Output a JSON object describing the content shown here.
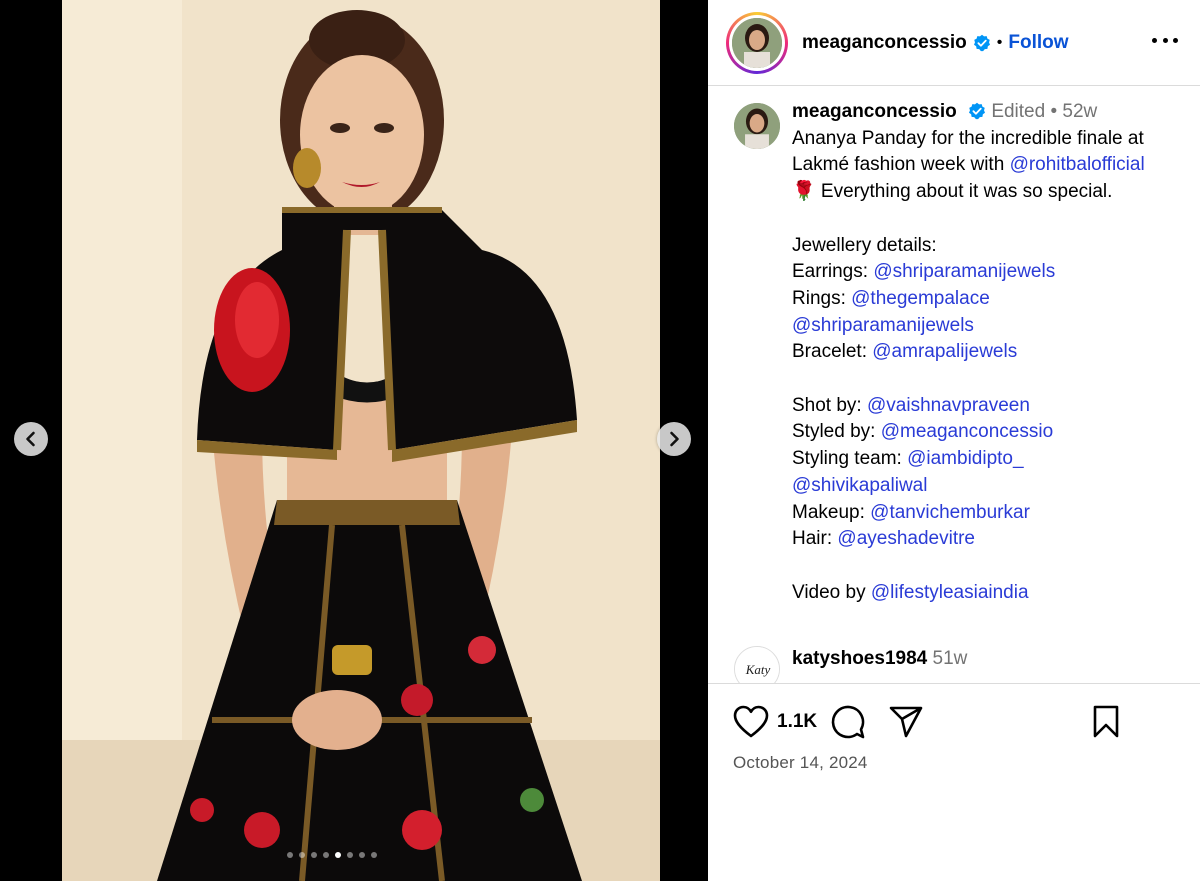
{
  "post": {
    "username": "meaganconcessio",
    "follow_label": "Follow",
    "separator": "•",
    "slides_total": 8,
    "slide_active": 5
  },
  "caption": {
    "username": "meaganconcessio",
    "edited": "Edited",
    "dot": "•",
    "age": "52w",
    "l1": "Ananya Panday for the incredible finale at",
    "l2a": "Lakmé fashion week with ",
    "l2link": "@rohitbalofficial",
    "l3": "🌹 Everything about it was so special.",
    "l4": "Jewellery details:",
    "l5a": "Earrings: ",
    "l5link": "@shriparamanijewels",
    "l6a": "Rings: ",
    "l6link": "@thegempalace",
    "l7link": "@shriparamanijewels",
    "l8a": "Bracelet: ",
    "l8link": "@amrapalijewels",
    "l9a": "Shot by: ",
    "l9link": "@vaishnavpraveen",
    "l10a": "Styled by: ",
    "l10link": "@meaganconcessio",
    "l11a": "Styling team: ",
    "l11link": "@iambidipto_",
    "l12link": "@shivikapaliwal",
    "l13a": "Makeup: ",
    "l13link": "@tanvichemburkar",
    "l14a": "Hair: ",
    "l14link": "@ayeshadevitre",
    "l15a": "Video by ",
    "l15link": "@lifestyleasiaindia"
  },
  "comment": {
    "username": "katyshoes1984",
    "age": "51w",
    "avatar_text": "Katy"
  },
  "actions": {
    "likes": "1.1K",
    "date": "October 14, 2024"
  },
  "icons": {
    "verified": "verified-badge-icon",
    "prev": "chevron-left-icon",
    "next": "chevron-right-icon",
    "more": "more-horizontal-icon",
    "like": "heart-icon",
    "comment": "comment-icon",
    "share": "send-icon",
    "save": "bookmark-icon"
  },
  "colors": {
    "link": "#2a3bd6",
    "follow": "#0a53d6",
    "verified": "#0095f6"
  }
}
